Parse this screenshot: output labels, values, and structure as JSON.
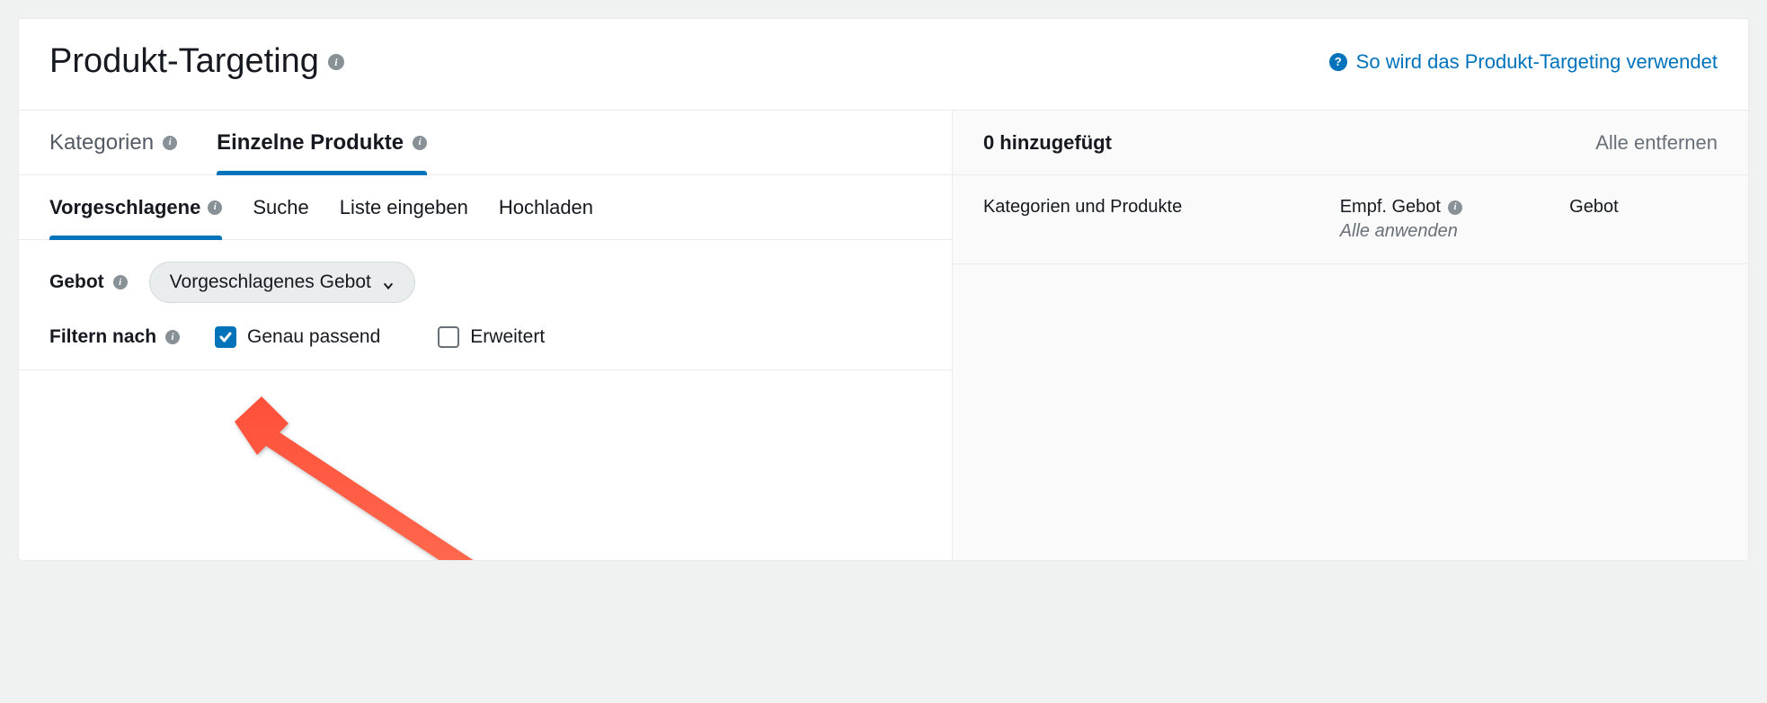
{
  "header": {
    "title": "Produkt-Targeting",
    "help_link": "So wird das Produkt-Targeting verwendet"
  },
  "left": {
    "tabs": {
      "categories": "Kategorien",
      "products": "Einzelne Produkte"
    },
    "subtabs": {
      "suggested": "Vorgeschlagene",
      "search": "Suche",
      "enter_list": "Liste eingeben",
      "upload": "Hochladen"
    },
    "bid_label": "Gebot",
    "bid_select": "Vorgeschlagenes Gebot",
    "filter_label": "Filtern nach",
    "filter_exact": "Genau passend",
    "filter_expanded": "Erweitert"
  },
  "right": {
    "added_count": "0 hinzugefügt",
    "remove_all": "Alle entfernen",
    "col_products": "Kategorien und Produkte",
    "col_rec_bid": "Empf. Gebot",
    "col_apply_all": "Alle anwenden",
    "col_bid": "Gebot"
  }
}
